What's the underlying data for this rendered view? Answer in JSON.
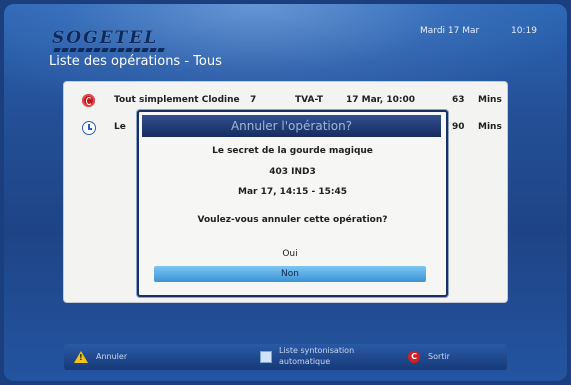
{
  "header": {
    "logo_text": "SOGETEL",
    "date": "Mardi 17 Mar",
    "time": "10:19",
    "page_title": "Liste des opérations - Tous"
  },
  "rows": [
    {
      "icon": "record-icon",
      "title": "Tout simplement Clodine",
      "episode": "7",
      "channel": "TVA-T",
      "datetime": "17 Mar, 10:00",
      "duration": "63",
      "unit": "Mins"
    },
    {
      "icon": "clock-icon",
      "title": "Le",
      "episode": "",
      "channel": "",
      "datetime": "",
      "duration": "90",
      "unit": "Mins"
    }
  ],
  "dialog": {
    "title": "Annuler l'opération?",
    "program_name": "Le secret de la gourde magique",
    "channel_info": "403  IND3",
    "schedule": "Mar 17, 14:15 - 15:45",
    "question": "Voulez-vous annuler cette opération?",
    "options": [
      "Oui",
      "Non"
    ],
    "selected_option": "Non"
  },
  "footer": {
    "cancel_label": "Annuler",
    "sync_label_line1": "Liste syntonisation",
    "sync_label_line2": "automatique",
    "exit_label": "Sortir",
    "exit_key": "C"
  },
  "colors": {
    "background": "#244f96",
    "panel": "#f3f3f1",
    "dialog_header": "#172b5e",
    "selection": "#3a93d6",
    "record_red": "#c3171d",
    "warning_yellow": "#f2c318"
  }
}
